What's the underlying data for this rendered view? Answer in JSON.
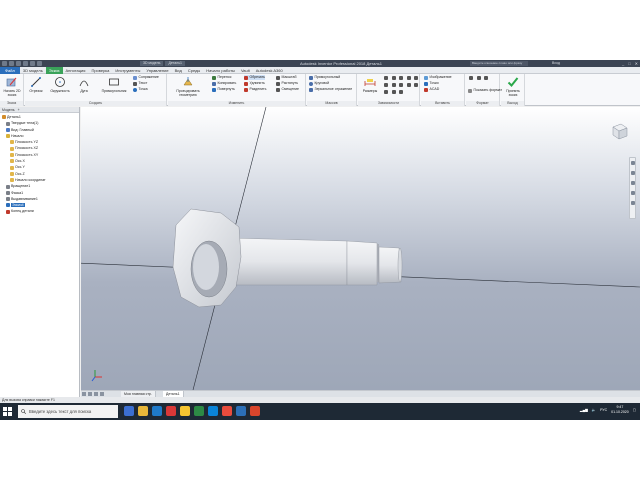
{
  "titlebar": {
    "doc_tabs": [
      "3D модель",
      "Деталь1"
    ],
    "app_title": "Autodesk Inventor Professional 2018   Деталь1",
    "search_placeholder": "Введите ключевое слово или фразу",
    "user": "Вход",
    "win_buttons": [
      "_",
      "□",
      "✕"
    ]
  },
  "menu": {
    "file": "Файл",
    "tabs": [
      "3D модель",
      "Эскиз",
      "Аннотация",
      "Проверка",
      "Инструменты",
      "Управление",
      "Вид",
      "Среды",
      "Начало работы",
      "Vault",
      "Autodesk A360"
    ],
    "active_index": 1
  },
  "ribbon": {
    "panels": [
      {
        "title": "Эскиз",
        "buttons": [
          "Начать 2D эскиз"
        ]
      },
      {
        "title": "Создать",
        "buttons": [
          "Отрезок",
          "Окружность",
          "Дуга",
          "Прямоугольник"
        ],
        "small": [
          "Сопряжение",
          "Текст",
          "Точка"
        ]
      },
      {
        "title": "Изменить",
        "buttons": [
          "Проецировать геометрию"
        ],
        "small": [
          "Перенос",
          "Обрезать",
          "Копировать",
          "Удлинить",
          "Повернуть",
          "Разделить",
          "Растянуть",
          "Смещение",
          "Масштаб"
        ]
      },
      {
        "title": "Массив",
        "small": [
          "Прямоугольный",
          "Круговой",
          "Зеркальное отражение"
        ]
      },
      {
        "title": "Зависимости",
        "buttons": [
          "Размеры"
        ]
      },
      {
        "title": "Вставить",
        "small": [
          "Изображение",
          "Точки",
          "ACAD"
        ]
      },
      {
        "title": "Формат",
        "small": [
          "Показать формат"
        ]
      },
      {
        "title": "Выход",
        "buttons": [
          "Принять эскиз"
        ]
      }
    ]
  },
  "browser": {
    "tabs": [
      "Модель",
      "+"
    ],
    "items": [
      {
        "label": "Деталь1",
        "indent": 0,
        "color": "#d28c2a"
      },
      {
        "label": "Твердые тела(1)",
        "indent": 1,
        "color": "#7a7f88"
      },
      {
        "label": "Вид: Главный",
        "indent": 1,
        "color": "#4b79c6"
      },
      {
        "label": "Начало",
        "indent": 1,
        "color": "#d8b23a"
      },
      {
        "label": "Плоскость YZ",
        "indent": 2,
        "color": "#e1b64a"
      },
      {
        "label": "Плоскость XZ",
        "indent": 2,
        "color": "#e1b64a"
      },
      {
        "label": "Плоскость XY",
        "indent": 2,
        "color": "#e1b64a"
      },
      {
        "label": "Ось X",
        "indent": 2,
        "color": "#e1b64a"
      },
      {
        "label": "Ось Y",
        "indent": 2,
        "color": "#e1b64a"
      },
      {
        "label": "Ось Z",
        "indent": 2,
        "color": "#e1b64a"
      },
      {
        "label": "Начало координат",
        "indent": 2,
        "color": "#e1b64a"
      },
      {
        "label": "Вращение1",
        "indent": 1,
        "color": "#7a7f88"
      },
      {
        "label": "Фаска1",
        "indent": 1,
        "color": "#7a7f88"
      },
      {
        "label": "Выдавливание1",
        "indent": 1,
        "color": "#7a7f88"
      },
      {
        "label": "Эскиз4",
        "indent": 1,
        "color": "#2a6ebb",
        "selected": true
      },
      {
        "label": "Конец детали",
        "indent": 1,
        "color": "#c0392b"
      }
    ]
  },
  "doc_tabs": [
    "Моя главная стр.",
    "Деталь1"
  ],
  "status_text": "Для вызова справки нажмите F1",
  "taskbar": {
    "search_placeholder": "Введите здесь текст для поиска",
    "app_colors": [
      "#3c6fd1",
      "#e8b73a",
      "#1f7ac9",
      "#d93838",
      "#f6c531",
      "#2d8a45",
      "#0a84d8",
      "#e84c3d",
      "#2c6fb7",
      "#d8452c"
    ],
    "lang": "РУС",
    "time": "9:47",
    "date": "01.10.2020"
  },
  "colors": {
    "accent": "#2a6ebb",
    "sketch_tab": "#3aa35a",
    "accept": "#2aa84a"
  }
}
